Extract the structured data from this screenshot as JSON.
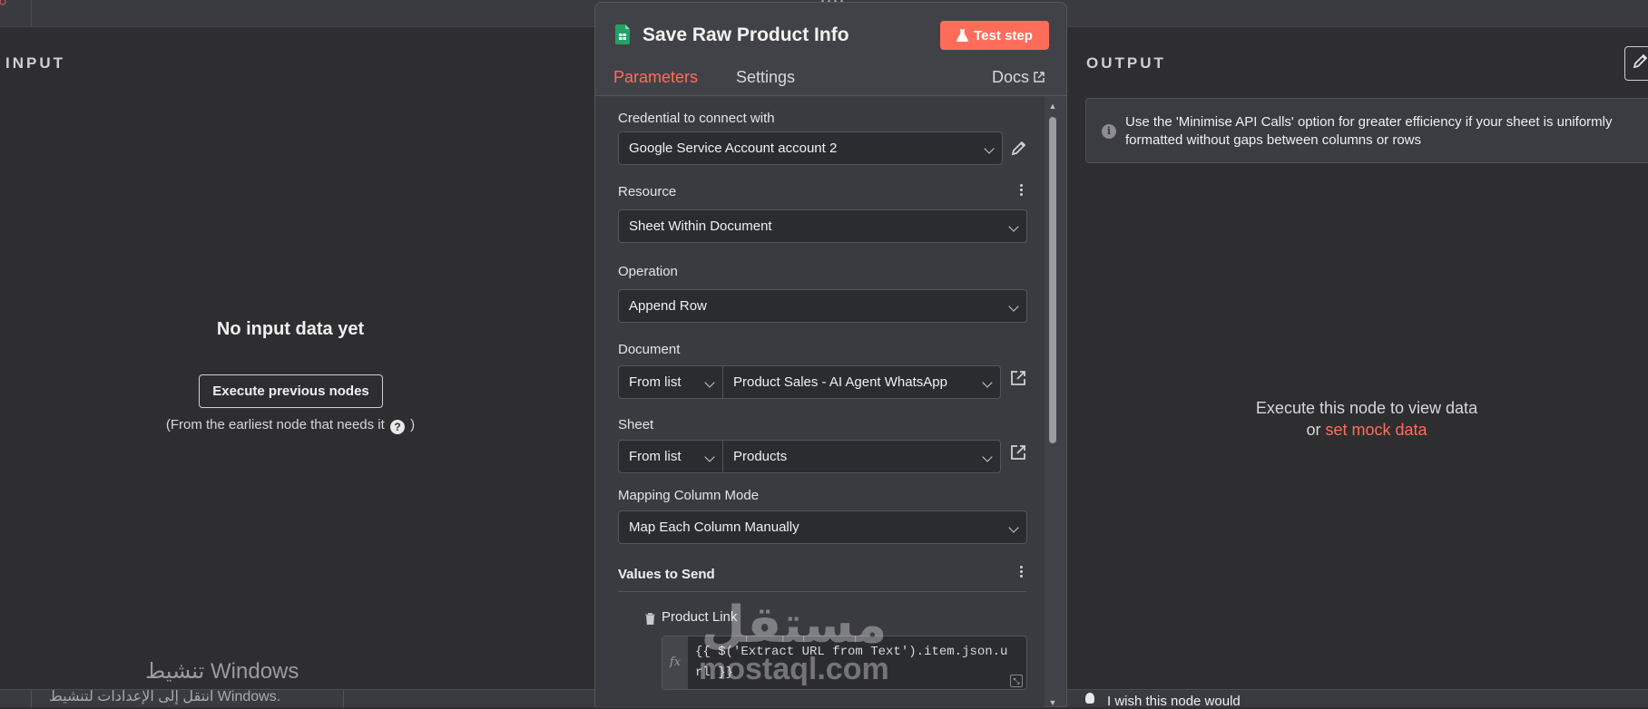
{
  "input_panel": {
    "title": "INPUT",
    "empty_title": "No input data yet",
    "execute_previous_label": "Execute previous nodes",
    "earliest_note_prefix": "(From the earliest node that needs it",
    "earliest_note_suffix": ")"
  },
  "node": {
    "title": "Save Raw Product Info",
    "test_step_label": "Test step",
    "tabs": {
      "parameters": "Parameters",
      "settings": "Settings",
      "docs": "Docs"
    },
    "fields": {
      "credential_label": "Credential to connect with",
      "credential_value": "Google Service Account account 2",
      "resource_label": "Resource",
      "resource_value": "Sheet Within Document",
      "operation_label": "Operation",
      "operation_value": "Append Row",
      "document_label": "Document",
      "document_mode": "From list",
      "document_value": "Product Sales - AI Agent WhatsApp",
      "sheet_label": "Sheet",
      "sheet_mode": "From list",
      "sheet_value": "Products",
      "mapping_label": "Mapping Column Mode",
      "mapping_value": "Map Each Column Manually",
      "values_to_send_label": "Values to Send",
      "product_link_label": "Product Link",
      "product_link_expression": "{{ $('Extract URL from Text').item.json.url }}"
    }
  },
  "output_panel": {
    "title": "OUTPUT",
    "info_text": "Use the 'Minimise API Calls' option for greater efficiency if your sheet is uniformly formatted without gaps between columns or rows",
    "execute_line1": "Execute this node to view data",
    "execute_or": "or",
    "mock_link": "set mock data",
    "wish_text": "I wish this node would"
  },
  "overlay": {
    "windows_activate": "تنشيط Windows",
    "windows_activate_sub": "انتقل إلى الإعدادات لتنشيط Windows.",
    "watermark_ar": "مستقل",
    "watermark_en": "mostaql.com"
  },
  "colors": {
    "accent": "#ff6d5a",
    "sheets_green": "#1fa463"
  }
}
